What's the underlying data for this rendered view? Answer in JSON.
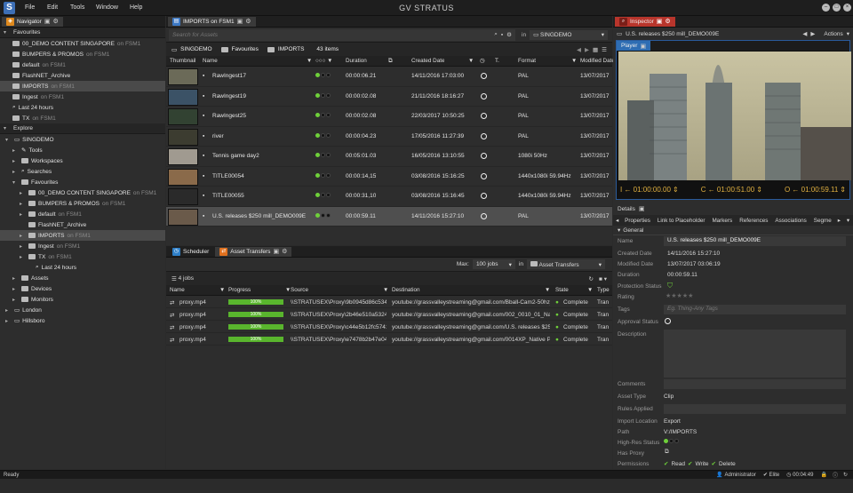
{
  "app": {
    "title": "GV STRATUS",
    "menu": [
      "File",
      "Edit",
      "Tools",
      "Window",
      "Help"
    ]
  },
  "navigator": {
    "tab_label": "Navigator",
    "favourites_title": "Favourites",
    "favourites": [
      {
        "name": "00_DEMO CONTENT SINGAPORE",
        "loc": "on FSM1"
      },
      {
        "name": "BUMPERS & PROMOS",
        "loc": "on FSM1"
      },
      {
        "name": "default",
        "loc": "on FSM1"
      },
      {
        "name": "FlashNET_Archive",
        "loc": ""
      },
      {
        "name": "IMPORTS",
        "loc": "on FSM1"
      },
      {
        "name": "Ingest",
        "loc": "on FSM1"
      },
      {
        "name": "Last  24 hours",
        "loc": ""
      },
      {
        "name": "TX",
        "loc": "on FSM1"
      }
    ],
    "explore_title": "Explore",
    "explore": [
      {
        "name": "SINGDEMO",
        "loc": ""
      },
      {
        "name": "Tools",
        "loc": ""
      },
      {
        "name": "Workspaces",
        "loc": ""
      },
      {
        "name": "Searches",
        "loc": ""
      },
      {
        "name": "Favourites",
        "loc": ""
      },
      {
        "name": "00_DEMO CONTENT SINGAPORE",
        "loc": "on FSM1"
      },
      {
        "name": "BUMPERS & PROMOS",
        "loc": "on FSM1"
      },
      {
        "name": "default",
        "loc": "on FSM1"
      },
      {
        "name": "FlashNET_Archive",
        "loc": ""
      },
      {
        "name": "IMPORTS",
        "loc": "on FSM1"
      },
      {
        "name": "Ingest",
        "loc": "on FSM1"
      },
      {
        "name": "TX",
        "loc": "on FSM1"
      },
      {
        "name": "Last  24 hours",
        "loc": ""
      },
      {
        "name": "Assets",
        "loc": ""
      },
      {
        "name": "Devices",
        "loc": ""
      },
      {
        "name": "Monitors",
        "loc": ""
      },
      {
        "name": "London",
        "loc": ""
      },
      {
        "name": "Hillsboro",
        "loc": ""
      }
    ]
  },
  "browser": {
    "tab_label": "IMPORTS on FSM1",
    "search_placeholder": "Search for Assets",
    "in_label": "in",
    "scope": "SINGDEMO",
    "breadcrumb": [
      "SINGDEMO",
      "Favourites",
      "IMPORTS"
    ],
    "item_count": "43 items",
    "columns": [
      "Thumbnail",
      "Name",
      "",
      "Duration",
      "",
      "Created Date",
      "",
      "T.",
      "Format",
      "Modified Date"
    ],
    "rows": [
      {
        "name": "RawIngest17",
        "duration": "00:00:06.21",
        "created": "14/11/2016 17:03:00",
        "format": "PAL",
        "modified": "13/07/2017"
      },
      {
        "name": "RawIngest19",
        "duration": "00:00:02.08",
        "created": "21/11/2016 18:16:27",
        "format": "PAL",
        "modified": "13/07/2017"
      },
      {
        "name": "RawIngest25",
        "duration": "00:00:02.08",
        "created": "22/03/2017 10:50:25",
        "format": "PAL",
        "modified": "13/07/2017"
      },
      {
        "name": "river",
        "duration": "00:00:04.23",
        "created": "17/05/2016 11:27:39",
        "format": "PAL",
        "modified": "13/07/2017"
      },
      {
        "name": "Tennis game day2",
        "duration": "00:05:01.03",
        "created": "16/05/2016 13:10:55",
        "format": "1080i 50Hz",
        "modified": "13/07/2017"
      },
      {
        "name": "TITLE00054",
        "duration": "00:00:14,15",
        "created": "03/08/2016 15:16:25",
        "format": "1440x1080i 59.94Hz",
        "modified": "13/07/2017"
      },
      {
        "name": "TITLE00055",
        "duration": "00:00:31,10",
        "created": "03/08/2016 15:16:45",
        "format": "1440x1080i 59.94Hz",
        "modified": "13/07/2017"
      },
      {
        "name": "U.S. releases $250 mill_DEMO009E",
        "duration": "00:00:59.11",
        "created": "14/11/2016 15:27:10",
        "format": "PAL",
        "modified": "13/07/2017"
      }
    ]
  },
  "jobs": {
    "tabs": [
      "Scheduler",
      "Asset Transfers"
    ],
    "max_label": "Max:",
    "max_value": "100 jobs",
    "in_label": "in",
    "filter": "Asset Transfers",
    "count": "4 jobs",
    "columns": [
      "Name",
      "Progress",
      "Source",
      "Destination",
      "State",
      "Type"
    ],
    "rows": [
      {
        "name": "proxy.mp4",
        "progress": "100%",
        "source": "\\\\STRATUSEX\\Proxy\\9b0945d86c5343...",
        "dest": "youtube://grassvalleystreaming@gmail.com/Bball-Cam2-50hz_1_...",
        "state": "Complete",
        "type": "Tran"
      },
      {
        "name": "proxy.mp4",
        "progress": "100%",
        "source": "\\\\STRATUSEX\\Proxy\\2b46e510a53244...",
        "dest": "youtube://grassvalleystreaming@gmail.com/002_0010_01_Nativ...",
        "state": "Complete",
        "type": "Tran"
      },
      {
        "name": "proxy.mp4",
        "progress": "100%",
        "source": "\\\\STRATUSEX\\Proxy\\c44e5b12fc5741e...",
        "dest": "youtube://grassvalleystreaming@gmail.com/U.S. releases $250 ...",
        "state": "Complete",
        "type": "Tran"
      },
      {
        "name": "proxy.mp4",
        "progress": "100%",
        "source": "\\\\STRATUSEX\\Proxy\\e7478b2b47e04b...",
        "dest": "youtube://grassvalleystreaming@gmail.com/0014XP_Native Prox...",
        "state": "Complete",
        "type": "Tran"
      }
    ]
  },
  "inspector": {
    "tab_label": "Inspector",
    "asset_title": "U.S. releases $250 mill_DEMO009E",
    "actions": "Actions",
    "player_tab": "Player",
    "tc_in": "I ← 01:00:00.00",
    "tc_current": "C ← 01:00:51.00",
    "tc_out": "O ← 01:00:59.11",
    "details_tab": "Details",
    "subtabs": [
      "Properties",
      "Link to Placeholder",
      "Markers",
      "References",
      "Associations",
      "Segme"
    ],
    "general": "General",
    "fields": {
      "name_label": "Name",
      "name": "U.S. releases $250 mill_DEMO009E",
      "created_label": "Created Date",
      "created": "14/11/2016 15:27:10",
      "modified_label": "Modified Date",
      "modified": "13/07/2017 03:06:19",
      "duration_label": "Duration",
      "duration": "00:00:59.11",
      "protection_label": "Protection Status",
      "rating_label": "Rating",
      "tags_label": "Tags",
      "tags_placeholder": "Eg. Thing-Any Tags",
      "approval_label": "Approval Status",
      "description_label": "Description",
      "comments_label": "Comments",
      "asset_type_label": "Asset Type",
      "asset_type": "Clip",
      "rules_label": "Rules Applied",
      "import_label": "Import Location",
      "import": "Export",
      "path_label": "Path",
      "path": "V:/IMPORTS",
      "hires_label": "High-Res Status",
      "proxy_label": "Has Proxy",
      "permissions_label": "Permissions",
      "perm_read": "Read",
      "perm_write": "Write",
      "perm_delete": "Delete"
    }
  },
  "status": {
    "left": "Ready",
    "user": "Administrator",
    "tier": "Elite",
    "time": "00:04:49"
  }
}
